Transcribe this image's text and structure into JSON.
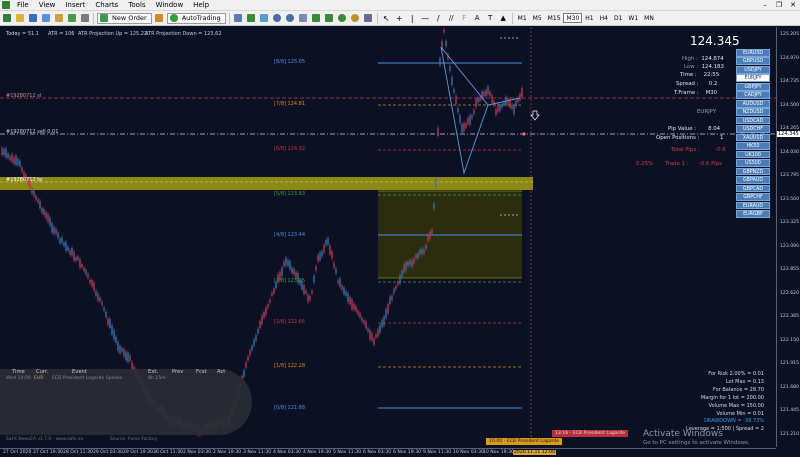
{
  "menu": {
    "items": [
      "File",
      "View",
      "Insert",
      "Charts",
      "Tools",
      "Window",
      "Help"
    ]
  },
  "toolbar": {
    "new_order": "New Order",
    "auto_trading": "AutoTrading",
    "timeframes": [
      "M1",
      "M5",
      "M15",
      "M30",
      "H1",
      "H4",
      "D1",
      "W1",
      "MN"
    ],
    "active_timeframe": "M30"
  },
  "header": {
    "today": "Today = 51.1",
    "atr": "ATR = 106",
    "atr_up": "ATR Projection Up = 125.22",
    "atr_down": "ATR Projection Down = 123.62"
  },
  "info": {
    "bid": "124.345",
    "high_label": "High :",
    "high": "124.874",
    "low_label": "Low :",
    "low": "124.183",
    "time_label": "Time :",
    "time": "22:55",
    "spread_label": "Spread :",
    "spread": "0.2",
    "tframe_label": "T.Frame :",
    "tframe": "M30",
    "symbol": "EURJPY",
    "pip_value_label": "Pip Value :",
    "pip_value": "8.04",
    "open_positions_label": "Open Positions :",
    "open_positions": "1",
    "total_pips_label": "Total Pips :",
    "total_pips": "-0.6",
    "risk_pct": "0.25%",
    "trade_label": "Trade 1 :",
    "trade_pips": "-0.6 Pips"
  },
  "symbols": [
    "EURUSD",
    "GBPUSD",
    "USDJPY",
    "EURJPY",
    "GBPJPY",
    "CADJPY",
    "AUDUSD",
    "NZDUSD",
    "USDCAD",
    "USDCHF",
    "XAUUSD",
    "HK50",
    "UK100",
    "US500",
    "GBPNZD",
    "GBPAUD",
    "GBPCAD",
    "GBPCHF",
    "EURAUD",
    "EURGBP"
  ],
  "selected_symbol": "EURJPY",
  "levels": {
    "l88": "[8/8]  125.05",
    "l78": "[7/8]  124.81",
    "l68": "[6/8]  124.32",
    "l58": "[5/8]  123.83",
    "l48": "[4/8]  123.44",
    "l38": "[3/8]  123.05",
    "l28": "[2/8]  122.66",
    "l18": "[1/8]  122.28",
    "l08": "[0/8]  121.88"
  },
  "left_labels": {
    "a": "#19280712 sl",
    "b": "#19280712 sell 0.01",
    "c": "#19280712 tp"
  },
  "price_axis": [
    "125.205",
    "124.970",
    "124.735",
    "124.500",
    "124.265",
    "124.030",
    "123.795",
    "123.560",
    "123.325",
    "123.090",
    "122.855",
    "122.620",
    "122.385",
    "122.150",
    "121.915",
    "121.680",
    "121.445",
    "121.210"
  ],
  "price_markers": {
    "current": "124.345"
  },
  "time_axis": [
    "27 Oct 2020",
    "27 Oct 19:30",
    "28 Oct 11:30",
    "29 Oct 03:30",
    "29 Oct 19:30",
    "30 Oct 11:30",
    "2 Nov 03:30",
    "2 Nov 19:30",
    "3 Nov 11:30",
    "4 Nov 03:30",
    "4 Nov 19:30",
    "5 Nov 11:30",
    "6 Nov 03:30",
    "6 Nov 19:30",
    "9 Nov 11:30",
    "10 Nov 03:30",
    "10 Nov 19:30",
    "2020.11.11 12:00"
  ],
  "events": {
    "headers": [
      "Time",
      "Curr.",
      "Event",
      "Ext.",
      "Prev",
      "Fcst",
      "Act"
    ],
    "row": [
      "Wed 14:00",
      "EUR",
      "ECB President Lagarde Speaks",
      "8h 15m"
    ]
  },
  "calc": {
    "risk": "For Risk 2.00% = 0.01",
    "lot_max": "Lot Max = 0.13",
    "balance": "For Balance = 28.70",
    "margin": "Margin for 1 lot = 200.00",
    "volume_max": "Volume Max = 150.00",
    "volume_min": "Volume Min = 0.01",
    "drawdown": "DRAWDOWN = -38.73%",
    "leverage": "Leverage = 1:500 | Spread = 2"
  },
  "news": {
    "one": "13:16 - ECB President Lagarde",
    "two": "16:00 - ECB President Lagarde"
  },
  "footer_left": "SaFX NewsEA v1.7.0  -  www.safx.eu",
  "footer_mid": "Source: Forex Factory",
  "activate": {
    "title": "Activate Windows",
    "sub": "Go to PC settings to activate Windows."
  },
  "colors": {
    "bg": "#0b1123",
    "bull": "#3e6ea9",
    "bear": "#b23b55",
    "level_blue": "#4a8fe0",
    "level_orange": "#d98a1f",
    "level_red": "#c8324a",
    "level_green": "#3d9e3d",
    "zone": "#8c8a14"
  }
}
